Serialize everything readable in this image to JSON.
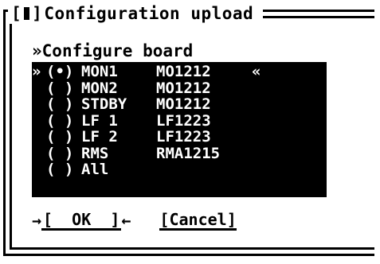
{
  "dialog": {
    "title": "Configuration upload",
    "close_left": "[",
    "close_right": "]",
    "header_marker": "»",
    "header_label": "Configure board"
  },
  "boards": [
    {
      "cursor": "»",
      "radio": "(•)",
      "name": "MON1",
      "version": "MO1212",
      "selected_marker": "«"
    },
    {
      "cursor": " ",
      "radio": "( )",
      "name": "MON2",
      "version": "MO1212",
      "selected_marker": ""
    },
    {
      "cursor": " ",
      "radio": "( )",
      "name": "STDBY",
      "version": "MO1212",
      "selected_marker": ""
    },
    {
      "cursor": " ",
      "radio": "( )",
      "name": "LF 1",
      "version": "LF1223",
      "selected_marker": ""
    },
    {
      "cursor": " ",
      "radio": "( )",
      "name": "LF 2",
      "version": "LF1223",
      "selected_marker": ""
    },
    {
      "cursor": " ",
      "radio": "( )",
      "name": "RMS",
      "version": "RMA1215",
      "selected_marker": ""
    },
    {
      "cursor": " ",
      "radio": "( )",
      "name": "All",
      "version": "",
      "selected_marker": ""
    }
  ],
  "buttons": {
    "ok_left_arrow": "→",
    "ok_label": "[  OK  ]",
    "ok_right_arrow": "←",
    "cancel_label": "[Cancel]"
  },
  "colors": {
    "background": "#ffffff",
    "list_background": "#000000",
    "text": "#000000",
    "list_text": "#ffffff"
  }
}
